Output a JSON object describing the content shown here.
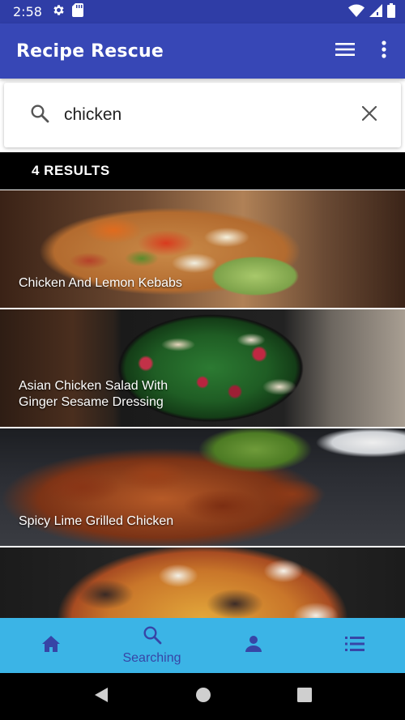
{
  "status_bar": {
    "time": "2:58",
    "icons": [
      "settings-icon",
      "sd-card-icon",
      "wifi-icon",
      "signal-icon",
      "battery-icon"
    ]
  },
  "app_bar": {
    "title": "Recipe Rescue",
    "actions": [
      "menu-icon",
      "more-vert-icon"
    ]
  },
  "search": {
    "value": "chicken",
    "icon": "search-icon",
    "clear_icon": "close-icon"
  },
  "results": {
    "label": "4 RESULTS"
  },
  "recipes": [
    {
      "title": "Chicken And Lemon Kebabs"
    },
    {
      "title": "Asian Chicken Salad With Ginger Sesame Dressing"
    },
    {
      "title": "Spicy Lime Grilled Chicken"
    },
    {
      "title": ""
    }
  ],
  "bottom_nav": {
    "items": [
      {
        "icon": "home-icon",
        "label": "",
        "active": false
      },
      {
        "icon": "search-icon",
        "label": "Searching",
        "active": true
      },
      {
        "icon": "person-icon",
        "label": "",
        "active": false
      },
      {
        "icon": "list-icon",
        "label": "",
        "active": false
      }
    ]
  },
  "colors": {
    "status_bar": "#2f3da6",
    "app_bar": "#3747b6",
    "bottom_nav": "#3bb4e6",
    "nav_icon": "#3745a6",
    "results_bar": "#000000"
  }
}
